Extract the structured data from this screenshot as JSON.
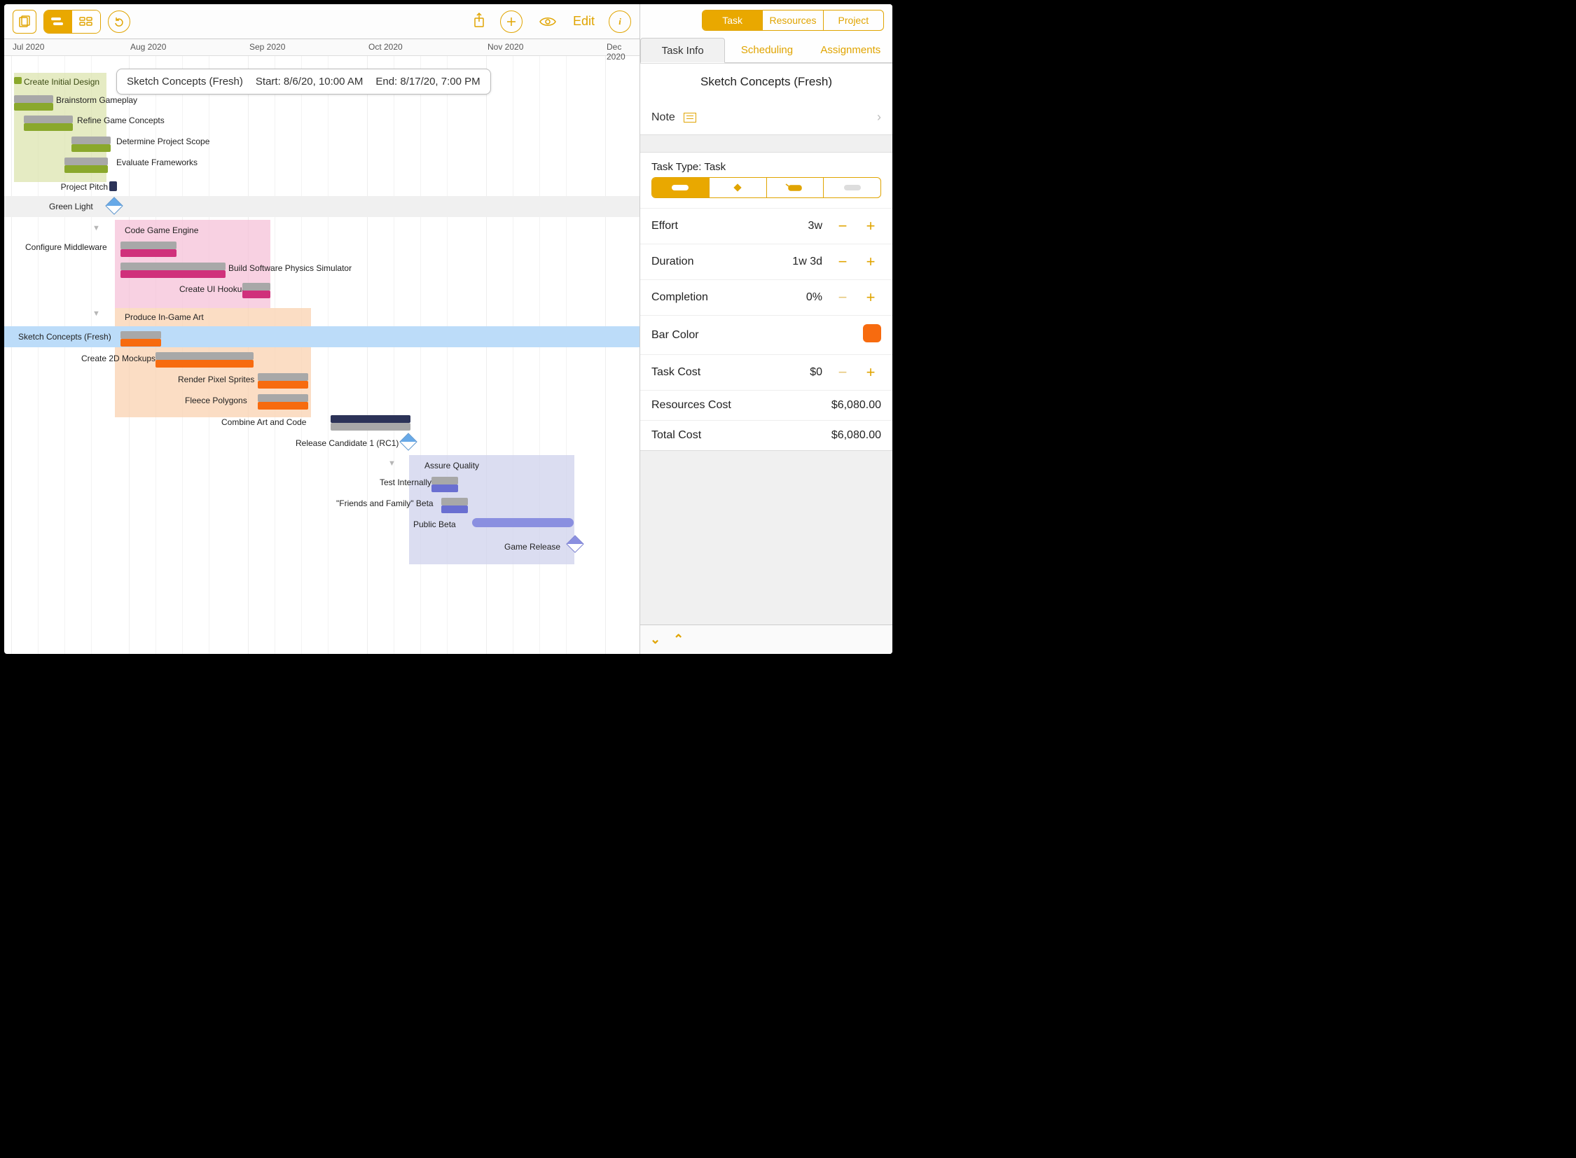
{
  "toolbar": {
    "edit_label": "Edit"
  },
  "timeline": {
    "months": [
      "Jul 2020",
      "Aug 2020",
      "Sep 2020",
      "Oct 2020",
      "Nov 2020",
      "Dec 2020"
    ]
  },
  "tooltip": {
    "title": "Sketch Concepts (Fresh)",
    "start": "Start: 8/6/20, 10:00 AM",
    "end": "End: 8/17/20, 7:00 PM"
  },
  "tasks": {
    "create_initial_design": "Create Initial Design",
    "brainstorm": "Brainstorm Gameplay",
    "refine": "Refine Game Concepts",
    "scope": "Determine Project Scope",
    "eval_fw": "Evaluate Frameworks",
    "pitch": "Project Pitch",
    "green": "Green Light",
    "code_engine": "Code Game Engine",
    "config_mw": "Configure Middleware",
    "build_sim": "Build Software Physics Simulator",
    "ui_hookups": "Create UI Hookups",
    "produce_art": "Produce In-Game Art",
    "sketch": "Sketch Concepts (Fresh)",
    "mockups": "Create 2D Mockups",
    "sprites": "Render Pixel Sprites",
    "fleece": "Fleece Polygons",
    "combine": "Combine Art and Code",
    "rc1": "Release Candidate 1 (RC1)",
    "assure": "Assure Quality",
    "test_int": "Test Internally",
    "ff_beta": "\"Friends and Family\" Beta",
    "public_beta": "Public Beta",
    "game_release": "Game Release"
  },
  "inspector": {
    "top_seg": {
      "task": "Task",
      "resources": "Resources",
      "project": "Project"
    },
    "tabs": {
      "info": "Task Info",
      "scheduling": "Scheduling",
      "assignments": "Assignments"
    },
    "task_title": "Sketch Concepts (Fresh)",
    "note": "Note",
    "type_label": "Task Type: Task",
    "effort_label": "Effort",
    "effort_value": "3w",
    "duration_label": "Duration",
    "duration_value": "1w 3d",
    "completion_label": "Completion",
    "completion_value": "0%",
    "barcolor_label": "Bar Color",
    "taskcost_label": "Task Cost",
    "taskcost_value": "$0",
    "rescost_label": "Resources Cost",
    "rescost_value": "$6,080.00",
    "totalcost_label": "Total Cost",
    "totalcost_value": "$6,080.00"
  }
}
